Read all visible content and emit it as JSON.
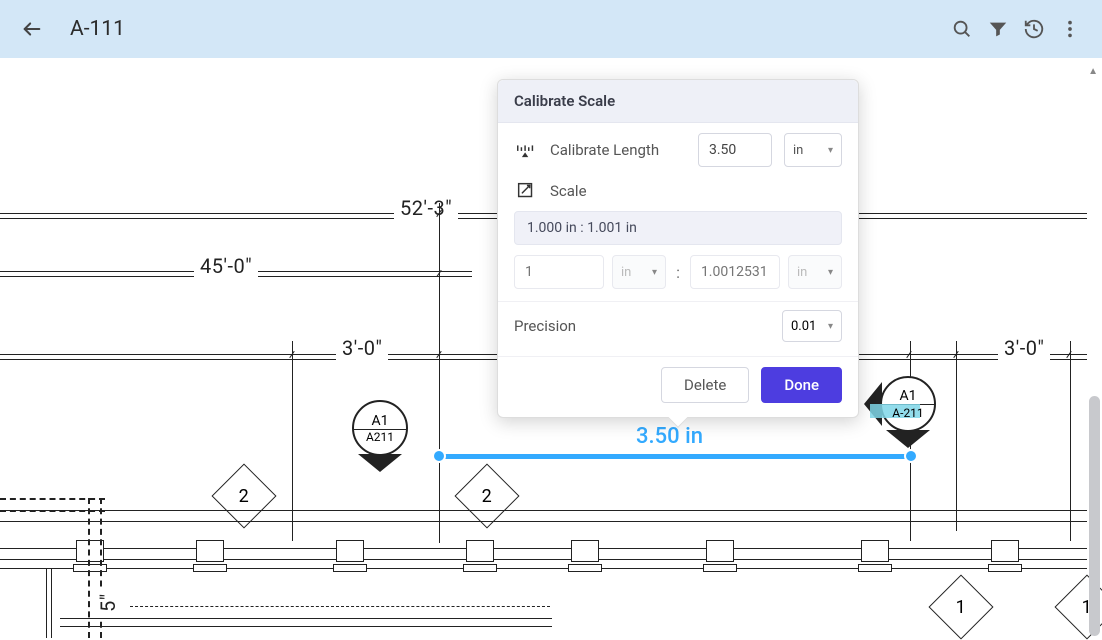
{
  "titlebar": {
    "title": "A-111"
  },
  "dimensions": {
    "overall": "52'-3\"",
    "left_span": "45'-0\"",
    "bay_left": "3'-0\"",
    "bay_right": "3'-0\""
  },
  "section_markers": {
    "m1": {
      "top": "A1",
      "bottom": "A211"
    },
    "m2": {
      "top": "A1",
      "bottom": "A-211"
    }
  },
  "grid_bubbles": {
    "d1": "2",
    "d2": "2",
    "d3": "1",
    "d4": "1"
  },
  "vertical_dim": "5\"",
  "measurement": {
    "label": "3.50 in"
  },
  "popup": {
    "title": "Calibrate Scale",
    "calibrate_label": "Calibrate Length",
    "calibrate_value": "3.50",
    "calibrate_unit": "in",
    "scale_label": "Scale",
    "scale_readout": "1.000 in : 1.001 in",
    "scale_left_value": "1",
    "scale_left_unit": "in",
    "scale_right_value": "1.0012531",
    "scale_right_unit": "in",
    "precision_label": "Precision",
    "precision_value": "0.01",
    "delete_label": "Delete",
    "done_label": "Done"
  }
}
